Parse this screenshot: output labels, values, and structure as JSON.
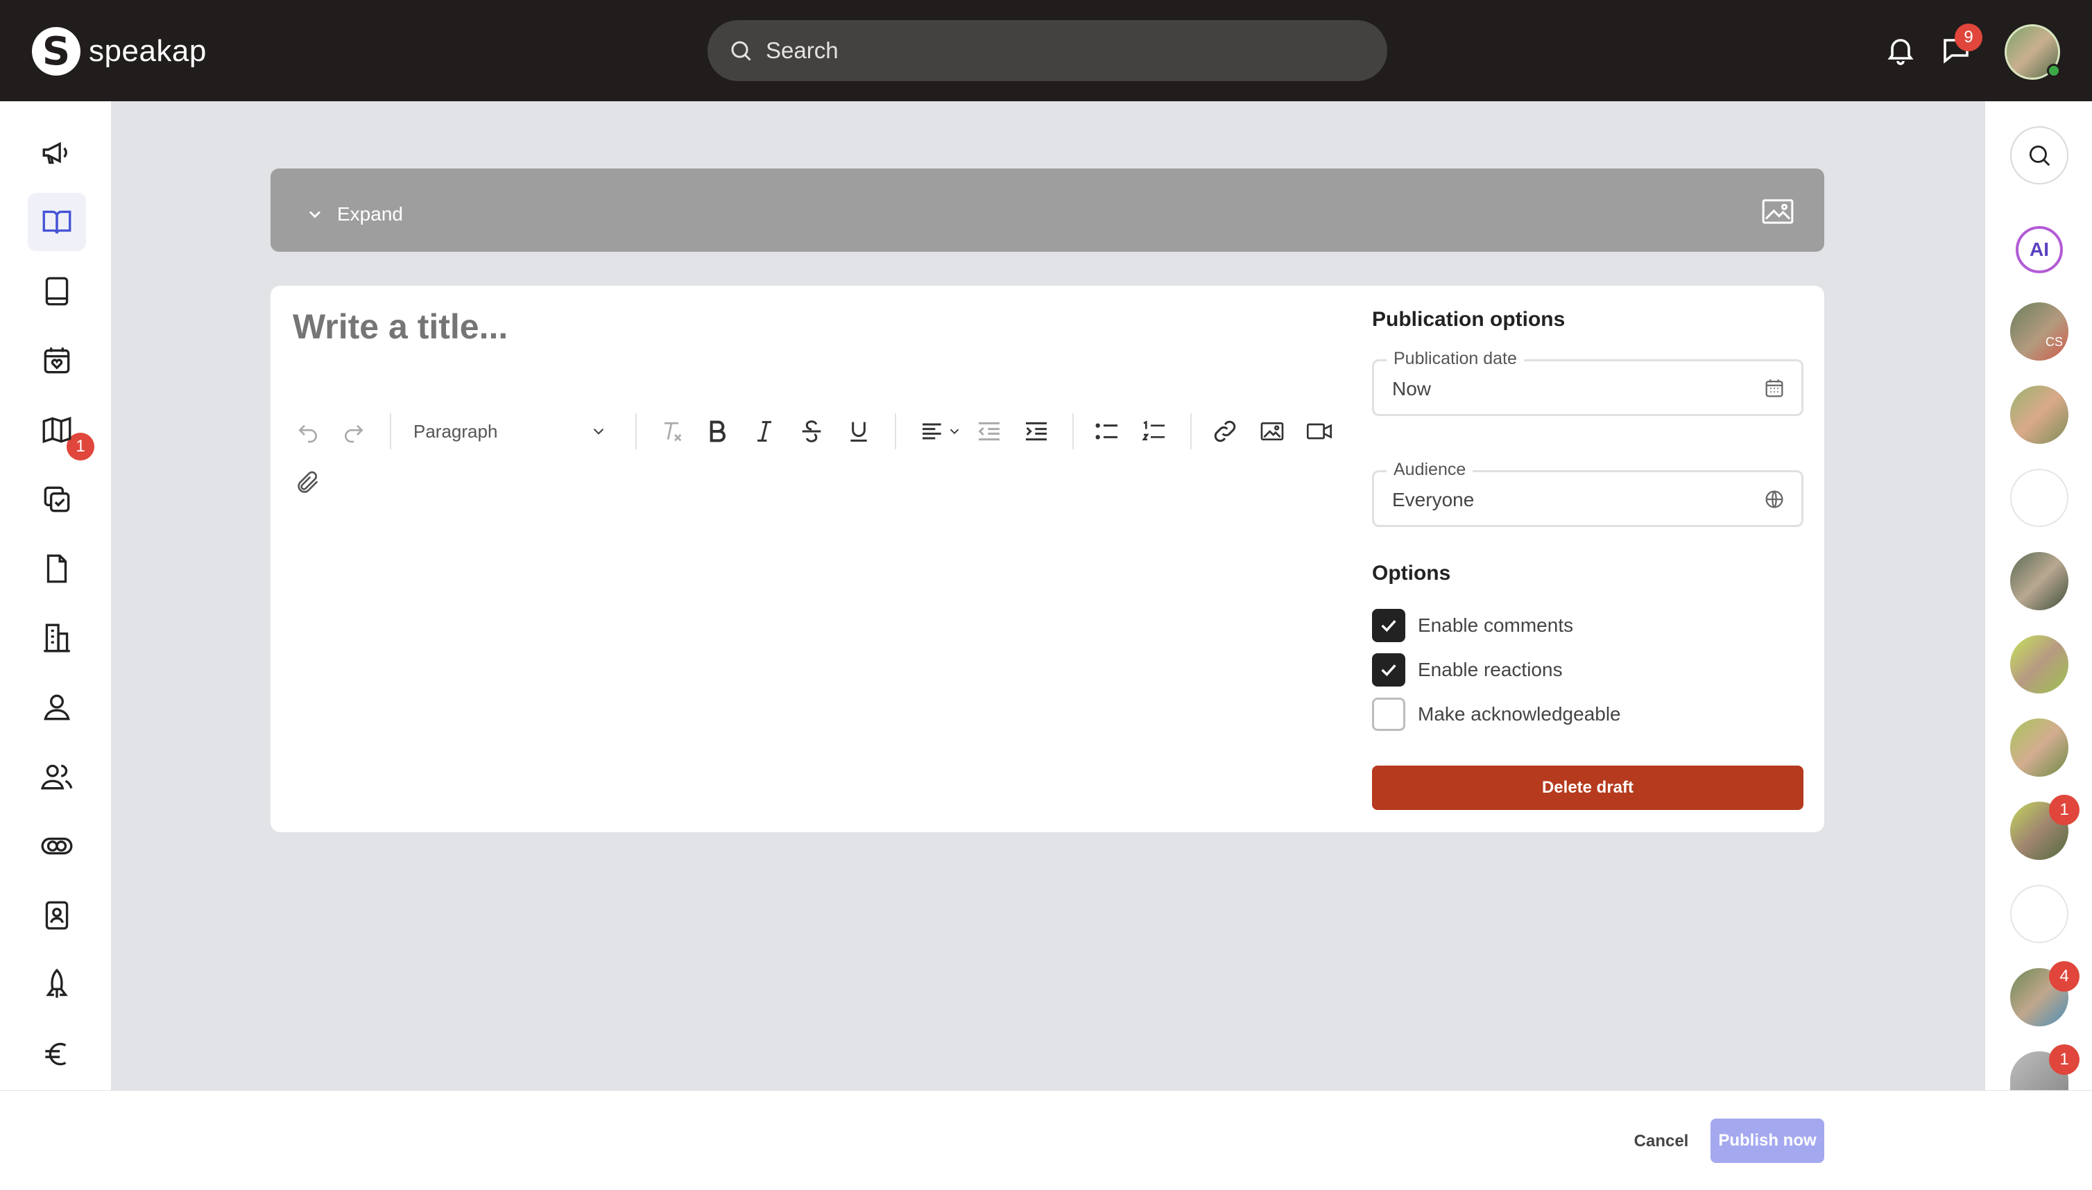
{
  "app": {
    "name": "speakap",
    "logo_letter": "S"
  },
  "header": {
    "search_placeholder": "Search",
    "notifications_icon": "bell-icon",
    "chat_icon": "chat-bubble-icon",
    "chat_badge": "9"
  },
  "left_nav": [
    {
      "icon": "megaphone-icon"
    },
    {
      "icon": "open-book-icon",
      "active": true
    },
    {
      "icon": "handbook-icon"
    },
    {
      "icon": "calendar-heart-icon",
      "badge": "1"
    },
    {
      "icon": "map-icon"
    },
    {
      "icon": "tasks-check-icon"
    },
    {
      "icon": "document-icon"
    },
    {
      "icon": "buildings-icon"
    },
    {
      "icon": "person-icon"
    },
    {
      "icon": "people-icon"
    },
    {
      "icon": "toggle-icon"
    },
    {
      "icon": "id-badge-icon"
    },
    {
      "icon": "rocket-icon"
    },
    {
      "icon": "euro-icon"
    }
  ],
  "right_rail": {
    "search_icon": "search-icon",
    "ai_label": "AI",
    "avatar_badges": [
      "",
      "",
      "",
      "",
      "",
      "",
      "1",
      "",
      "4",
      "1"
    ],
    "avatar_initials": "CS"
  },
  "cover": {
    "expand_label": "Expand"
  },
  "editor": {
    "title_placeholder": "Write a title...",
    "block_style": "Paragraph"
  },
  "publication": {
    "title": "Publication options",
    "date_label": "Publication date",
    "date_value": "Now",
    "audience_label": "Audience",
    "audience_value": "Everyone",
    "options_title": "Options",
    "options": [
      {
        "label": "Enable comments",
        "checked": true
      },
      {
        "label": "Enable reactions",
        "checked": true
      },
      {
        "label": "Make acknowledgeable",
        "checked": false
      }
    ],
    "delete_label": "Delete draft"
  },
  "footer": {
    "cancel_label": "Cancel",
    "publish_label": "Publish now"
  },
  "colors": {
    "topbar": "#211d1c",
    "badge": "#e0463b",
    "delete": "#b53a1e",
    "publish": "#a4a9ef"
  }
}
